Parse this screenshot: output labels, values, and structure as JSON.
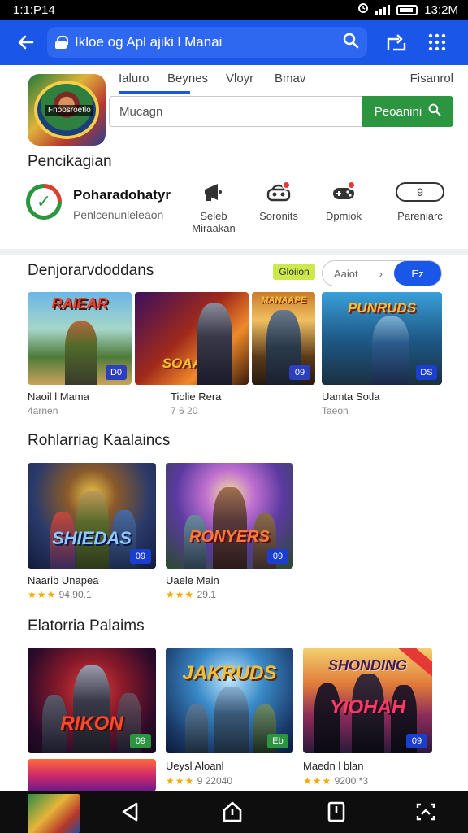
{
  "status_bar": {
    "time": "1:1:P14",
    "right_time": "13:2M"
  },
  "appbar": {
    "url": "Ikloe og Apl ajiki l Manai"
  },
  "header": {
    "tabs": [
      "Ialuro",
      "Beynes",
      "Vloyr",
      "Bmav",
      "Fisanrol"
    ],
    "app_thumb_label": "Fnoosroetlo",
    "search_placeholder": "Mucagn",
    "search_button": "Peoanini"
  },
  "section_label": "Pencikagian",
  "status_row": {
    "title": "Poharadohatyr",
    "subtitle": "Penlcenunleleaon",
    "actions": [
      {
        "label": "Seleb\nMiraakan"
      },
      {
        "label": "Soronits"
      },
      {
        "label": "Dpmiok"
      },
      {
        "label": "Pareniarc",
        "pill": "9"
      }
    ]
  },
  "section1": {
    "title": "Denjorarvdoddans",
    "tag": "Gloiion",
    "seg_left": "Aaiot",
    "seg_right": "Ez",
    "items": [
      {
        "art": "RAIEAR",
        "badge": "D0",
        "name": "Naoil l Mama",
        "sub": "4arnen"
      },
      {
        "art": "SOAAUS",
        "badge": "",
        "name": "Tiolie Rera",
        "sub": "7 6 20"
      },
      {
        "art": "MANAAPE",
        "badge": "09",
        "name": "",
        "sub": ""
      },
      {
        "art": "PUNRUDS",
        "badge": "DS",
        "name": "Uamta Sotla",
        "sub": "Taeon"
      }
    ]
  },
  "section2": {
    "title": "Rohlarriag Kaalaincs",
    "items": [
      {
        "art": "SHIEDAS",
        "badge": "09",
        "name": "Naarib Unapea",
        "stars": "★★★",
        "rating": "94.90.1"
      },
      {
        "art": "RONYERS",
        "badge": "09",
        "name": "Uaele Main",
        "stars": "★★★",
        "rating": "29.1"
      }
    ]
  },
  "section3": {
    "title": "Elatorria Palaims",
    "items": [
      {
        "art": "RIKON",
        "badge": "09",
        "name": "",
        "stars": "",
        "rating": ""
      },
      {
        "art": "JAKRUDS",
        "badge": "Eb",
        "name": "Ueysl Aloanl",
        "stars": "★★★",
        "rating": "9 22040"
      },
      {
        "art": "YIOHAH",
        "badge": "09",
        "name": "Maedn l blan",
        "stars": "★★★",
        "rating": "9200 *3"
      }
    ]
  },
  "colors": {
    "primary": "#1a56e8",
    "green": "#2c9540",
    "badge_blue": "#1a3fd0",
    "badge_green": "#2c9540"
  }
}
